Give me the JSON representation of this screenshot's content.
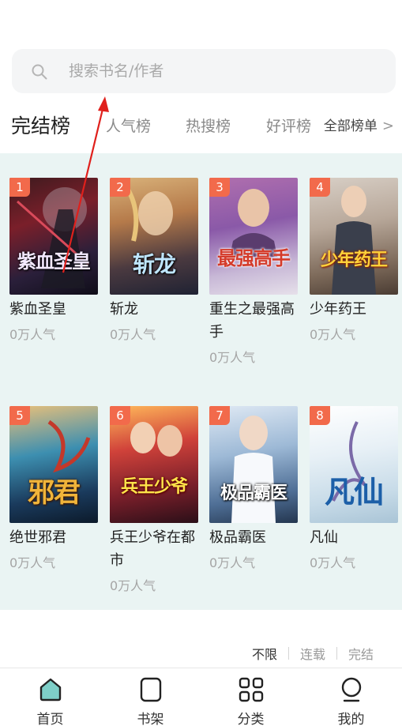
{
  "search": {
    "placeholder": "搜索书名/作者"
  },
  "tabs": [
    {
      "label": "完结榜",
      "active": true
    },
    {
      "label": "人气榜",
      "active": false
    },
    {
      "label": "热搜榜",
      "active": false
    },
    {
      "label": "好评榜",
      "active": false
    }
  ],
  "all_lists": {
    "label": "全部榜单",
    "icon": "chevron-right-icon"
  },
  "books": [
    {
      "rank": "1",
      "name": "紫血圣皇",
      "popularity": "0万人气",
      "cover_text": "紫血圣皇"
    },
    {
      "rank": "2",
      "name": "斩龙",
      "popularity": "0万人气",
      "cover_text": "斩龙"
    },
    {
      "rank": "3",
      "name": "重生之最强高手",
      "popularity": "0万人气",
      "cover_text": "最强高手"
    },
    {
      "rank": "4",
      "name": "少年药王",
      "popularity": "0万人气",
      "cover_text": "少年药王"
    },
    {
      "rank": "5",
      "name": "绝世邪君",
      "popularity": "0万人气",
      "cover_text": "邪君"
    },
    {
      "rank": "6",
      "name": "兵王少爷在都市",
      "popularity": "0万人气",
      "cover_text": "兵王少爷"
    },
    {
      "rank": "7",
      "name": "极品霸医",
      "popularity": "0万人气",
      "cover_text": "极品霸医"
    },
    {
      "rank": "8",
      "name": "凡仙",
      "popularity": "0万人气",
      "cover_text": "凡仙"
    }
  ],
  "filter": {
    "options": [
      "不限",
      "连载",
      "完结"
    ],
    "selected": "不限"
  },
  "tabbar": [
    {
      "label": "首页",
      "icon": "home-icon",
      "active": true
    },
    {
      "label": "书架",
      "icon": "bookshelf-icon",
      "active": false
    },
    {
      "label": "分类",
      "icon": "category-grid-icon",
      "active": false
    },
    {
      "label": "我的",
      "icon": "profile-icon",
      "active": false
    }
  ],
  "colors": {
    "accent": "#7ecfc8",
    "rank_badge": "#f26a4b",
    "panel_bg": "#eaf4f3",
    "annotation_arrow": "#e0201c"
  }
}
